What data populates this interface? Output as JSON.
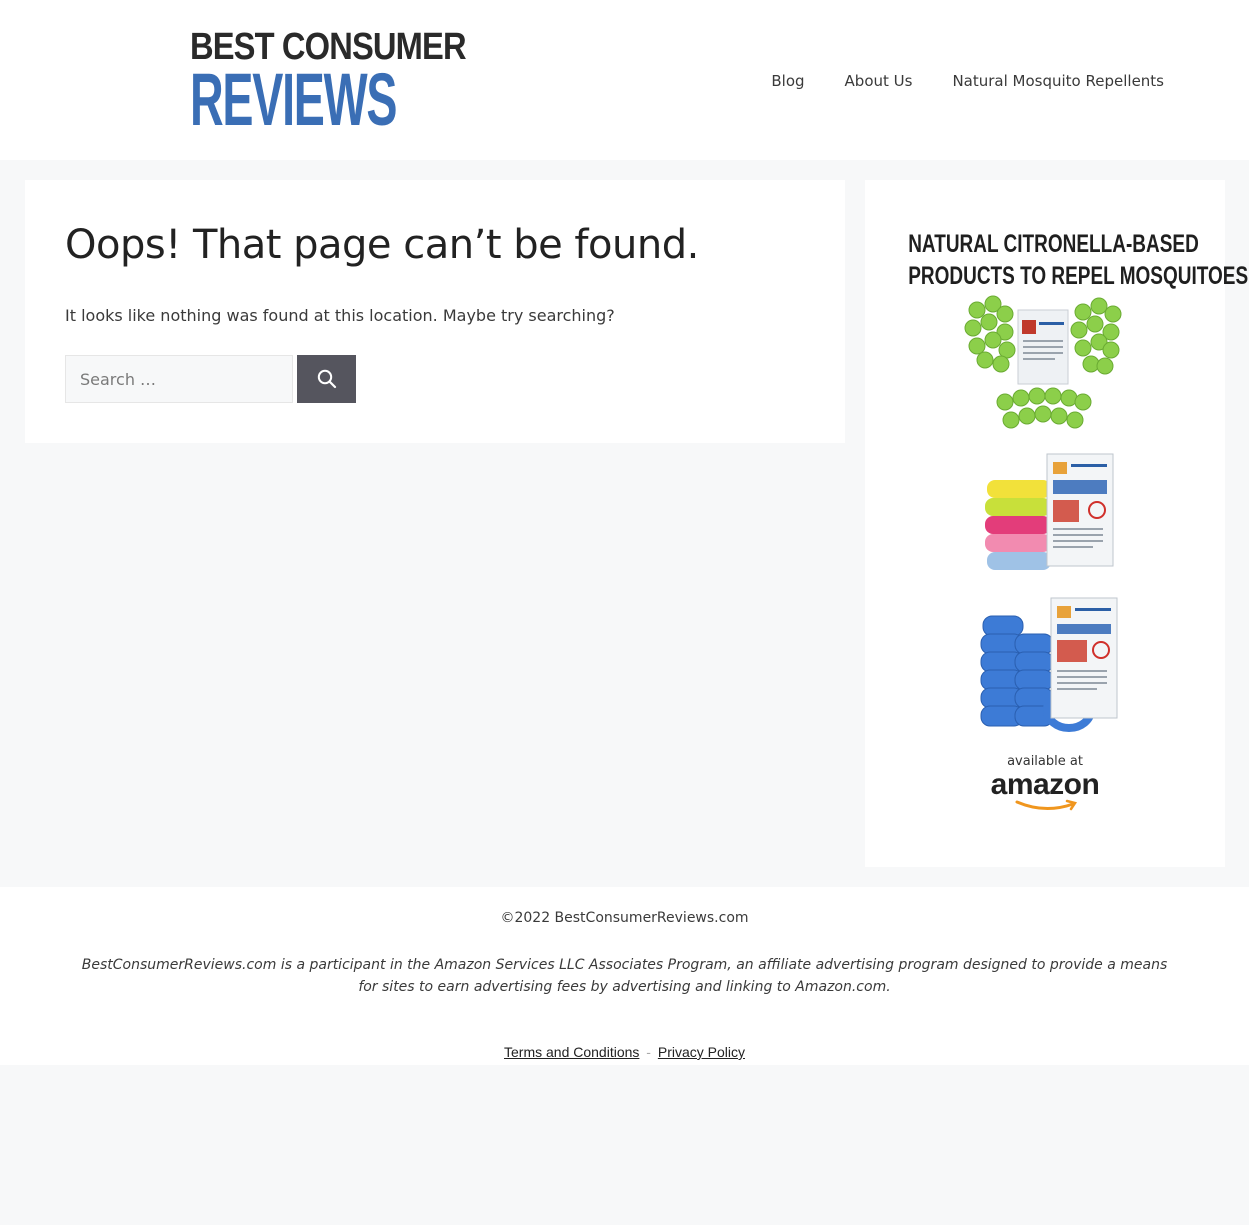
{
  "header": {
    "logo_line1": "BEST CONSUMER",
    "logo_line2": "REVIEWS",
    "nav": [
      {
        "label": "Blog"
      },
      {
        "label": "About Us"
      },
      {
        "label": "Natural Mosquito Repellents"
      }
    ]
  },
  "main": {
    "title": "Oops! That page can’t be found.",
    "message": "It looks like nothing was found at this location. Maybe try searching?",
    "search": {
      "placeholder": "Search …",
      "value": "",
      "icon": "search-icon"
    }
  },
  "sidebar": {
    "ad_title_line1": "NATURAL CITRONELLA-BASED",
    "ad_title_line2": "PRODUCTS TO REPEL MOSQUITOES",
    "available_text": "available at",
    "amazon_text": "amazon"
  },
  "footer": {
    "copyright": "©2022 BestConsumerReviews.com",
    "disclaimer": "BestConsumerReviews.com is a participant in the Amazon Services LLC Associates Program, an affiliate advertising program designed to provide a means for sites to earn advertising fees by advertising and linking to Amazon.com.",
    "links": [
      {
        "label": "Terms and Conditions"
      },
      {
        "label": "Privacy Policy"
      }
    ],
    "separator": "-"
  },
  "colors": {
    "brand_blue": "#3a6eb5",
    "search_button": "#55555e",
    "background": "#f7f8f9"
  }
}
